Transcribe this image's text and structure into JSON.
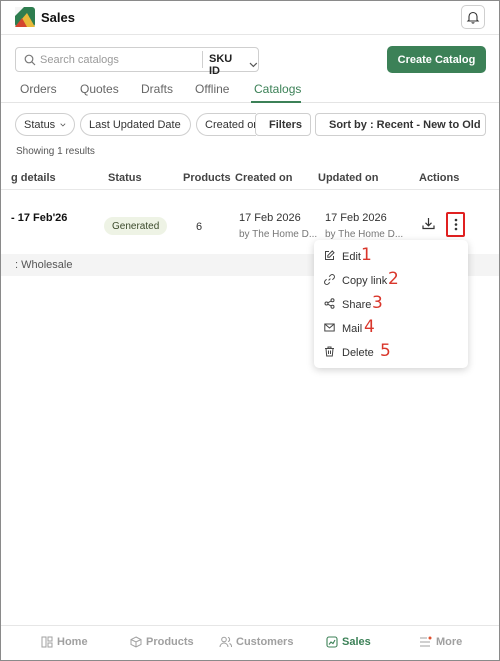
{
  "header": {
    "title": "Sales"
  },
  "search": {
    "placeholder": "Search catalogs",
    "field": "SKU ID"
  },
  "create_button": "Create Catalog",
  "tabs": [
    {
      "label": "Orders",
      "active": false
    },
    {
      "label": "Quotes",
      "active": false
    },
    {
      "label": "Drafts",
      "active": false
    },
    {
      "label": "Offline",
      "active": false
    },
    {
      "label": "Catalogs",
      "active": true
    }
  ],
  "filters": {
    "status": "Status",
    "last_updated": "Last Updated Date",
    "created_on": "Created on",
    "filters_btn": "Filters",
    "sort": "Sort by : Recent - New to Old"
  },
  "results_text": "Showing 1 results",
  "table": {
    "headers": {
      "details": "g details",
      "status": "Status",
      "products": "Products",
      "created_on": "Created on",
      "updated_on": "Updated on",
      "actions": "Actions"
    },
    "row": {
      "details": "- 17 Feb'26",
      "status": "Generated",
      "products": "6",
      "created_date": "17 Feb 2026",
      "created_by": "by The Home D...",
      "updated_date": "17 Feb 2026",
      "updated_by": "by The Home D...",
      "sub": ": Wholesale"
    }
  },
  "menu": [
    {
      "label": "Edit",
      "icon": "edit-icon",
      "num": "1"
    },
    {
      "label": "Copy link",
      "icon": "link-icon",
      "num": "2"
    },
    {
      "label": "Share",
      "icon": "share-icon",
      "num": "3"
    },
    {
      "label": "Mail",
      "icon": "mail-icon",
      "num": "4"
    },
    {
      "label": "Delete",
      "icon": "trash-icon",
      "num": "5"
    }
  ],
  "bottom_nav": [
    {
      "label": "Home",
      "icon": "home-icon",
      "active": false
    },
    {
      "label": "Products",
      "icon": "box-icon",
      "active": false
    },
    {
      "label": "Customers",
      "icon": "users-icon",
      "active": false
    },
    {
      "label": "Sales",
      "icon": "sales-icon",
      "active": true
    },
    {
      "label": "More",
      "icon": "menu-icon",
      "active": false
    }
  ],
  "colors": {
    "accent": "#3c8157",
    "highlight": "#e02020",
    "annotation": "#d9362b"
  }
}
